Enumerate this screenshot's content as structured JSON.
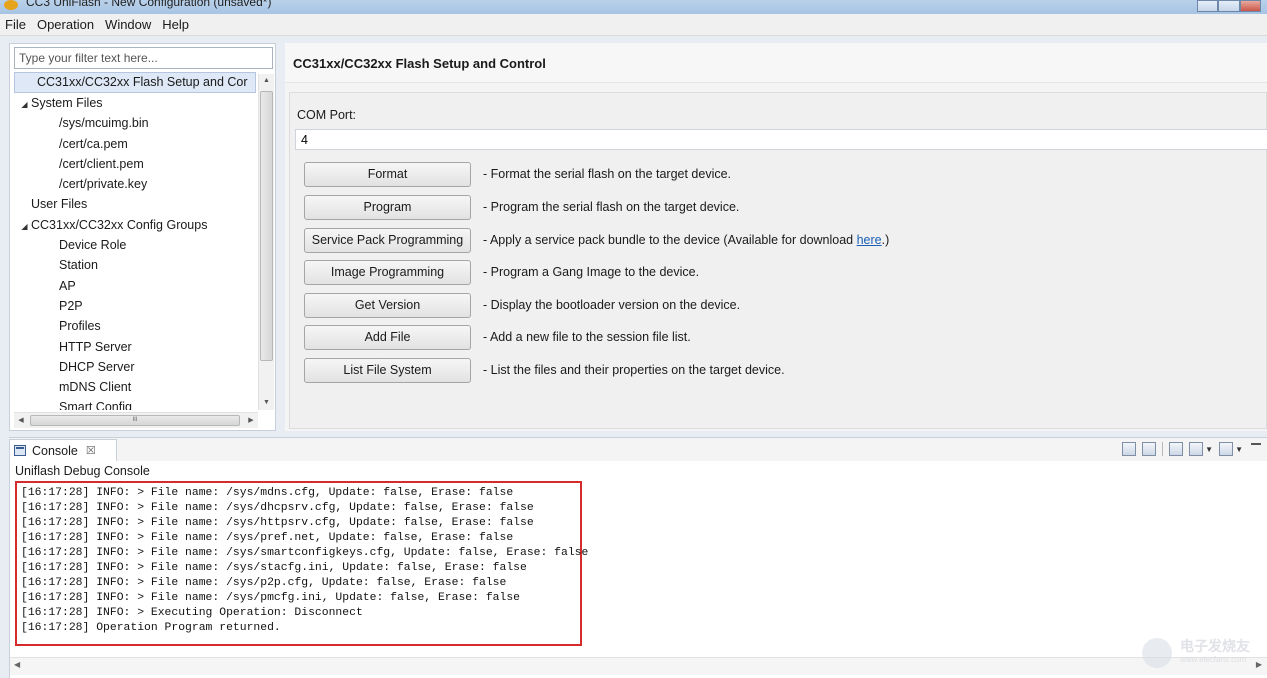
{
  "window": {
    "title": "CC3 UniFlash - New Configuration (unsaved*)"
  },
  "menubar": {
    "items": [
      "File",
      "Operation",
      "Window",
      "Help"
    ]
  },
  "sidebar": {
    "filter_placeholder": "Type your filter text here...",
    "items": [
      {
        "label": "CC31xx/CC32xx Flash Setup and Cor",
        "level": 0,
        "selected": true
      },
      {
        "label": "System Files",
        "level": 1,
        "expanded": true
      },
      {
        "label": "/sys/mcuimg.bin",
        "level": 2
      },
      {
        "label": "/cert/ca.pem",
        "level": 2
      },
      {
        "label": "/cert/client.pem",
        "level": 2
      },
      {
        "label": "/cert/private.key",
        "level": 2
      },
      {
        "label": "User Files",
        "level": 1
      },
      {
        "label": "CC31xx/CC32xx Config Groups",
        "level": 1,
        "expanded": true
      },
      {
        "label": "Device Role",
        "level": 2
      },
      {
        "label": "Station",
        "level": 2
      },
      {
        "label": "AP",
        "level": 2
      },
      {
        "label": "P2P",
        "level": 2
      },
      {
        "label": "Profiles",
        "level": 2
      },
      {
        "label": "HTTP Server",
        "level": 2
      },
      {
        "label": "DHCP Server",
        "level": 2
      },
      {
        "label": "mDNS Client",
        "level": 2
      },
      {
        "label": "Smart Config",
        "level": 2
      }
    ],
    "hscroll_grip": "III"
  },
  "main": {
    "title": "CC31xx/CC32xx Flash Setup and Control",
    "com_port_label": "COM Port:",
    "com_port_value": "4",
    "actions": [
      {
        "button": "Format",
        "desc": "- Format the serial flash on the target device."
      },
      {
        "button": "Program",
        "desc": "- Program the serial flash on the target device."
      },
      {
        "button": "Service Pack Programming",
        "desc": "- Apply a service pack bundle to the device (Available for download ",
        "link": "here",
        "desc_after": ".)"
      },
      {
        "button": "Image Programming",
        "desc": "- Program a Gang Image to the device."
      },
      {
        "button": "Get Version",
        "desc": "- Display the bootloader version on the device."
      },
      {
        "button": "Add File",
        "desc": "- Add a new file to the session file list."
      },
      {
        "button": "List File System",
        "desc": "- List the files and their properties on the target device."
      }
    ]
  },
  "console": {
    "tab_label": "Console",
    "tab_close": "☒",
    "title": "Uniflash Debug Console",
    "lines": [
      "[16:17:28] INFO: > File name: /sys/mdns.cfg, Update: false, Erase: false",
      "[16:17:28] INFO: > File name: /sys/dhcpsrv.cfg, Update: false, Erase: false",
      "[16:17:28] INFO: > File name: /sys/httpsrv.cfg, Update: false, Erase: false",
      "[16:17:28] INFO: > File name: /sys/pref.net, Update: false, Erase: false",
      "[16:17:28] INFO: > File name: /sys/smartconfigkeys.cfg, Update: false, Erase: false",
      "[16:17:28] INFO: > File name: /sys/stacfg.ini, Update: false, Erase: false",
      "[16:17:28] INFO: > File name: /sys/p2p.cfg, Update: false, Erase: false",
      "[16:17:28] INFO: > File name: /sys/pmcfg.ini, Update: false, Erase: false",
      "[16:17:28] INFO: > Executing Operation: Disconnect",
      "[16:17:28] Operation Program returned."
    ],
    "highlight_color": "#d62b2b"
  },
  "watermark": {
    "text1": "电子发烧友",
    "text2": "www.elecfans.com"
  }
}
